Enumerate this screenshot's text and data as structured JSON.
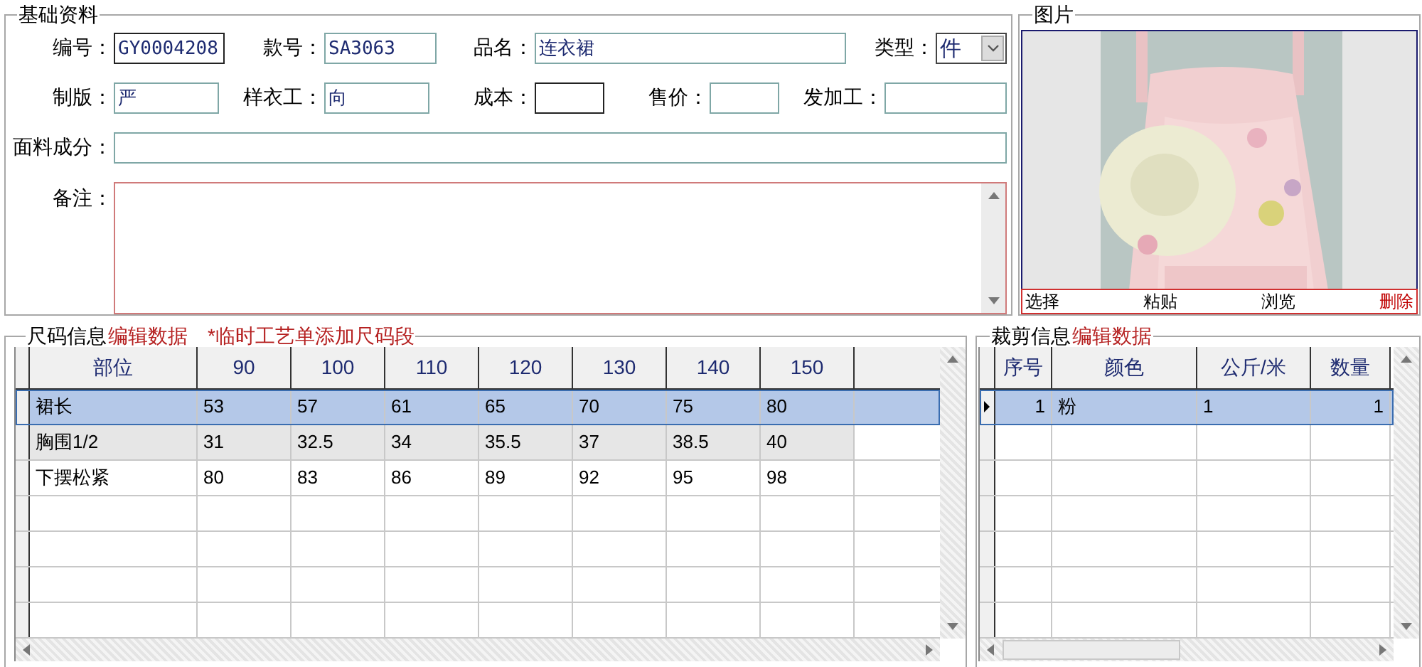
{
  "basic_info": {
    "title": "基础资料",
    "rows": [
      [
        {
          "label": "编号：",
          "value": "GY0004208",
          "kind": "framed"
        },
        {
          "label": "款号：",
          "value": "SA3063",
          "kind": "text"
        },
        {
          "label": "品名：",
          "value": "连衣裙",
          "kind": "text"
        },
        {
          "label": "类型：",
          "value": "件",
          "kind": "select"
        }
      ],
      [
        {
          "label": "制版：",
          "value": "严",
          "kind": "text"
        },
        {
          "label": "样衣工：",
          "value": "向",
          "kind": "text"
        },
        {
          "label": "成本：",
          "kind": "framed"
        },
        {
          "label": "售价：",
          "kind": "text"
        },
        {
          "label": "发加工：",
          "kind": "text"
        }
      ],
      [
        {
          "label": "面料成分：",
          "kind": "text"
        }
      ],
      [
        {
          "label": "备注：",
          "kind": "memo"
        }
      ]
    ]
  },
  "picture": {
    "title": "图片",
    "kind": "picture",
    "buttons": [
      {
        "label": "选择",
        "color": "#000000"
      },
      {
        "label": "粘贴",
        "color": "#000000"
      },
      {
        "label": "浏览",
        "color": "#000000"
      },
      {
        "label": "删除",
        "color": "#c00000"
      }
    ]
  },
  "size_info": {
    "title": "尺码信息",
    "links": [
      "编辑数据",
      "*临时工艺单添加尺码段"
    ],
    "columns": [
      "部位",
      "90",
      "100",
      "110",
      "120",
      "130",
      "140",
      "150"
    ],
    "rows": [
      {
        "cells": [
          "裙长",
          "53",
          "57",
          "61",
          "65",
          "70",
          "75",
          "80"
        ],
        "selected": true,
        "shaded": false
      },
      {
        "cells": [
          "胸围1/2",
          "31",
          "32.5",
          "34",
          "35.5",
          "37",
          "38.5",
          "40"
        ],
        "selected": false,
        "shaded": true
      },
      {
        "cells": [
          "下摆松紧",
          "80",
          "83",
          "86",
          "89",
          "92",
          "95",
          "98"
        ],
        "selected": false,
        "shaded": false
      }
    ]
  },
  "cut_info": {
    "title": "裁剪信息",
    "links": [
      "编辑数据"
    ],
    "columns": [
      "序号",
      "颜色",
      "公斤/米",
      "数量"
    ],
    "rows": [
      {
        "cells": [
          "1",
          "粉",
          "1",
          "1"
        ],
        "selected": true
      }
    ]
  }
}
